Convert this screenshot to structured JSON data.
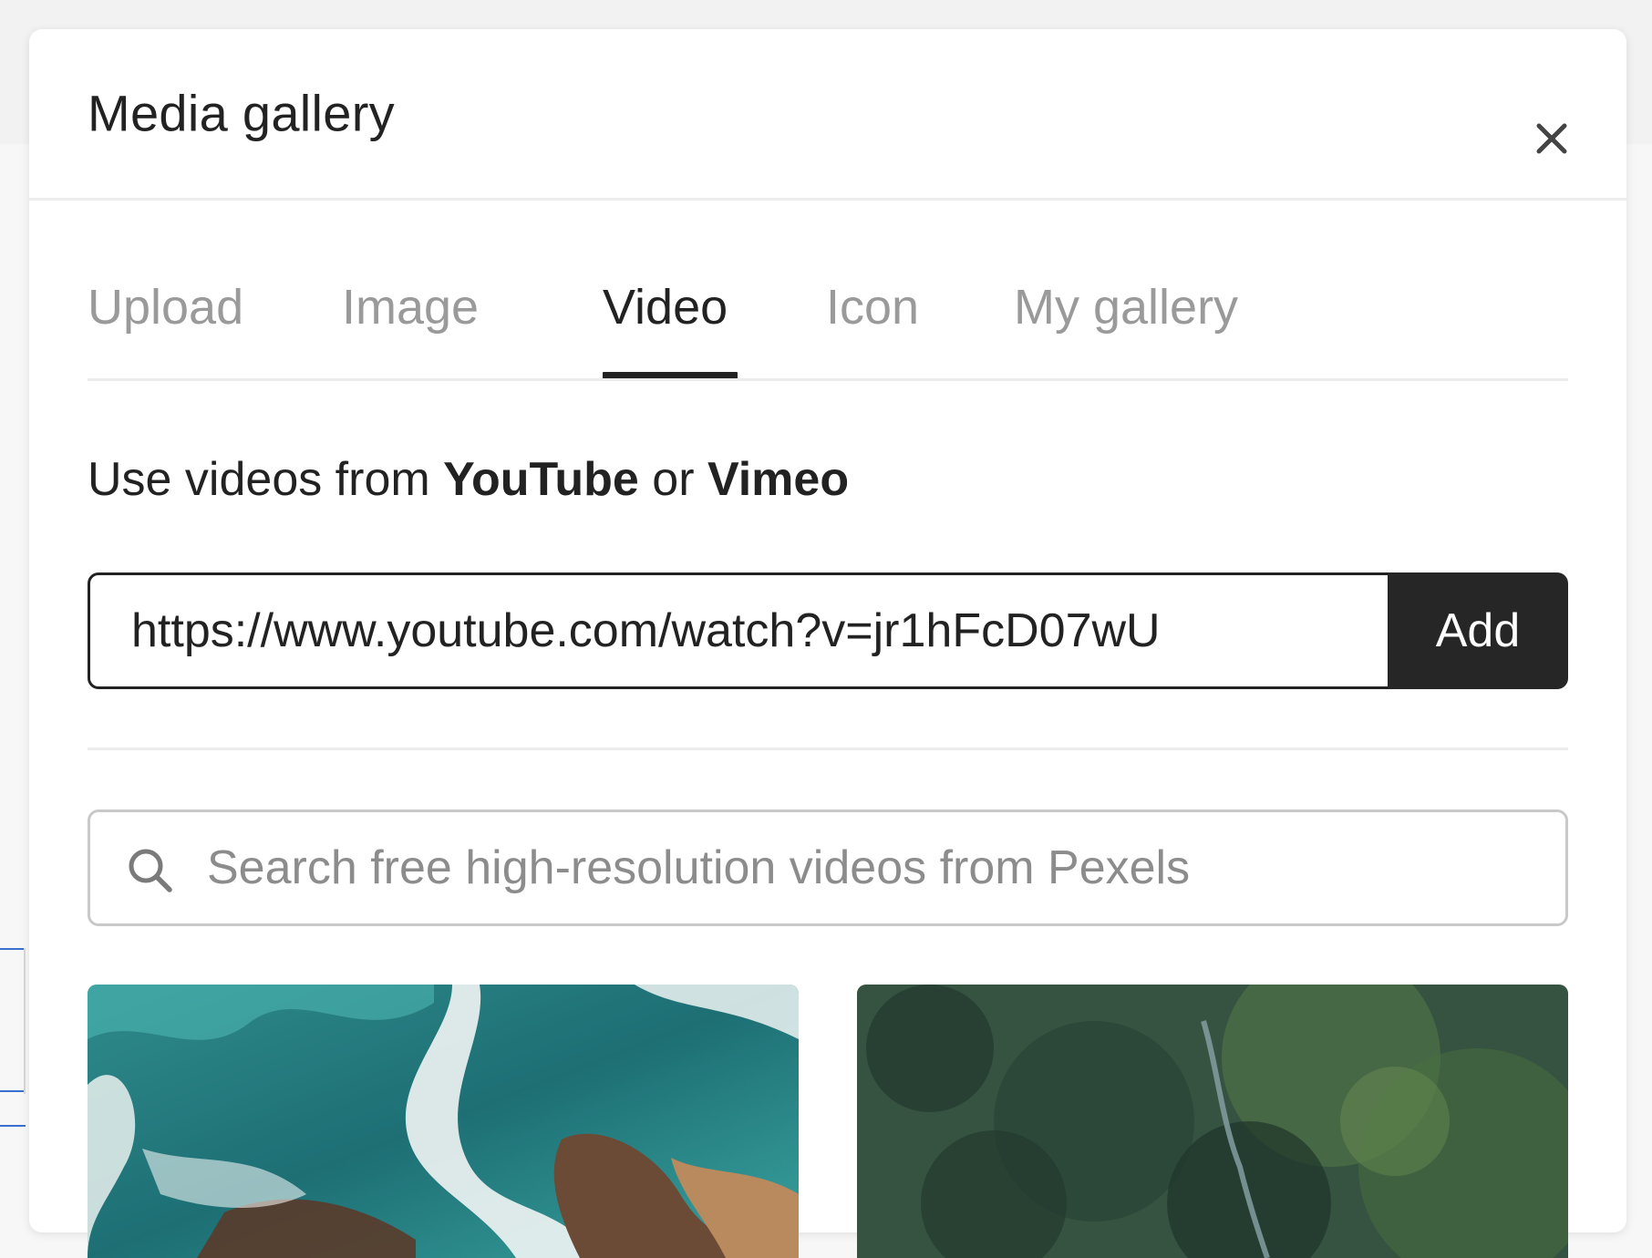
{
  "dialog": {
    "title": "Media gallery"
  },
  "tabs": [
    {
      "label": "Upload",
      "active": false
    },
    {
      "label": "Image",
      "active": false
    },
    {
      "label": "Video",
      "active": true
    },
    {
      "label": "Icon",
      "active": false
    },
    {
      "label": "My gallery",
      "active": false
    }
  ],
  "intro": {
    "prefix": "Use videos from ",
    "source1": "YouTube",
    "connector": " or ",
    "source2": "Vimeo"
  },
  "url_form": {
    "value": "https://www.youtube.com/watch?v=jr1hFcD07wU",
    "add_label": "Add"
  },
  "search": {
    "placeholder": "Search free high-resolution videos from Pexels",
    "icon": "search-icon"
  },
  "videos": [
    {
      "subject": "ocean"
    },
    {
      "subject": "forest"
    }
  ],
  "colors": {
    "text": "#222222",
    "muted": "#9a9a9a",
    "button_bg": "#262626",
    "accent_blue": "#3b6fcf"
  }
}
